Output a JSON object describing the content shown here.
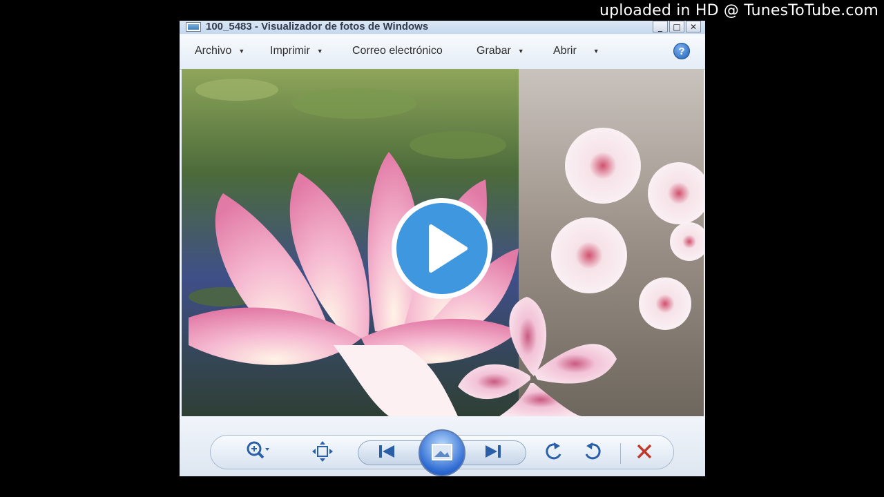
{
  "watermark": "uploaded in HD @ TunesToTube.com",
  "window": {
    "title": "100_5483 - Visualizador de fotos de Windows",
    "caption_buttons": {
      "minimize": "_",
      "maximize": "□",
      "close": "✕"
    }
  },
  "menubar": {
    "items": [
      {
        "label": "Archivo",
        "has_dropdown": true
      },
      {
        "label": "Imprimir",
        "has_dropdown": true
      },
      {
        "label": "Correo electrónico",
        "has_dropdown": false
      },
      {
        "label": "Grabar",
        "has_dropdown": true
      },
      {
        "label": "Abrir",
        "has_dropdown": true
      }
    ],
    "help_label": "?"
  },
  "controls": {
    "icons": [
      "zoom-icon",
      "fit-to-window-icon",
      "previous-icon",
      "slideshow-icon",
      "next-icon",
      "rotate-left-icon",
      "rotate-right-icon",
      "delete-icon"
    ]
  },
  "colors": {
    "accent": "#3f98df",
    "delete": "#c0392b",
    "lotus": "#f2a8c4",
    "blossom": "#f7e3ea"
  }
}
